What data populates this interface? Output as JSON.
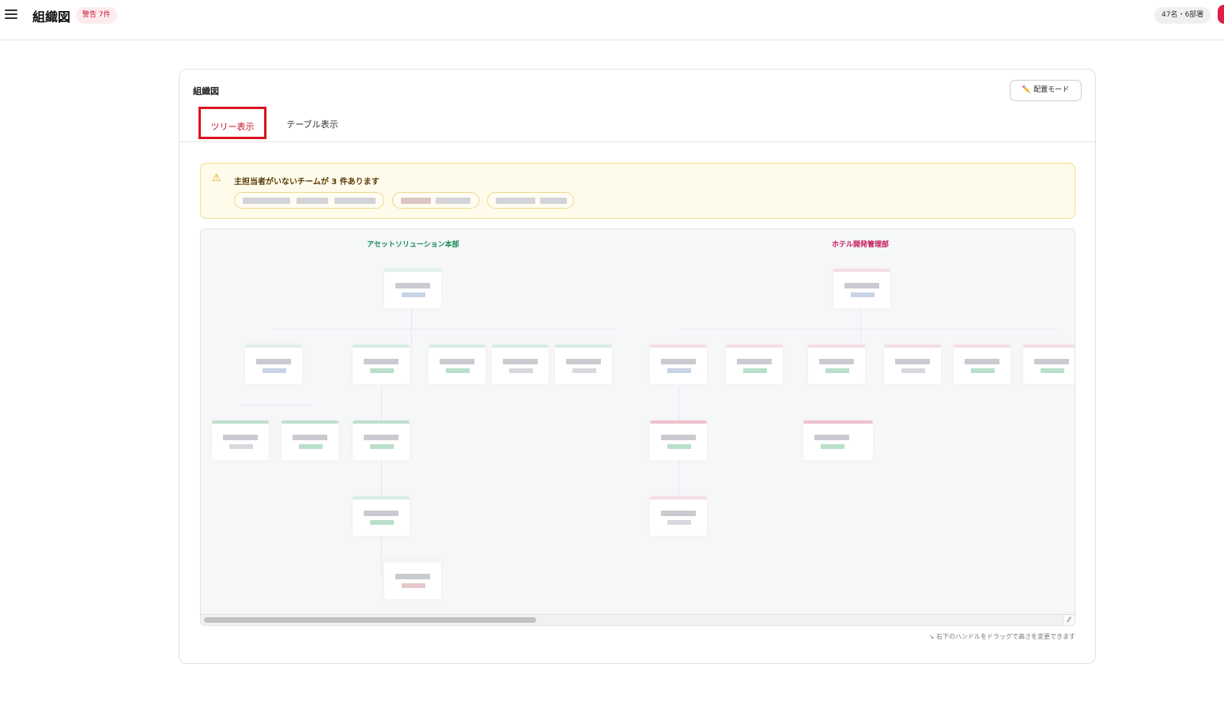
{
  "header": {
    "title": "組織図",
    "warning_badge": "警告 7件",
    "count": "47名・6部署",
    "colors": {
      "accent": "#c8102e",
      "badge_bg": "#fdecee"
    }
  },
  "card": {
    "title": "組織図",
    "mode_button": "配置モード",
    "tabs": [
      {
        "label": "ツリー表示",
        "active": true
      },
      {
        "label": "テーブル表示",
        "active": false
      }
    ]
  },
  "alert": {
    "icon": "warning-triangle-icon",
    "text": "主担当者がいないチームが 3 件あります"
  },
  "chart": {
    "departments": [
      {
        "name": "アセットソリューション本部",
        "color": "#1b8a57"
      },
      {
        "name": "ホテル開発管理部",
        "color": "#c2185b"
      }
    ]
  },
  "footer": {
    "resize_hint": "↘ 右下のハンドルをドラッグで高さを変更できます"
  }
}
